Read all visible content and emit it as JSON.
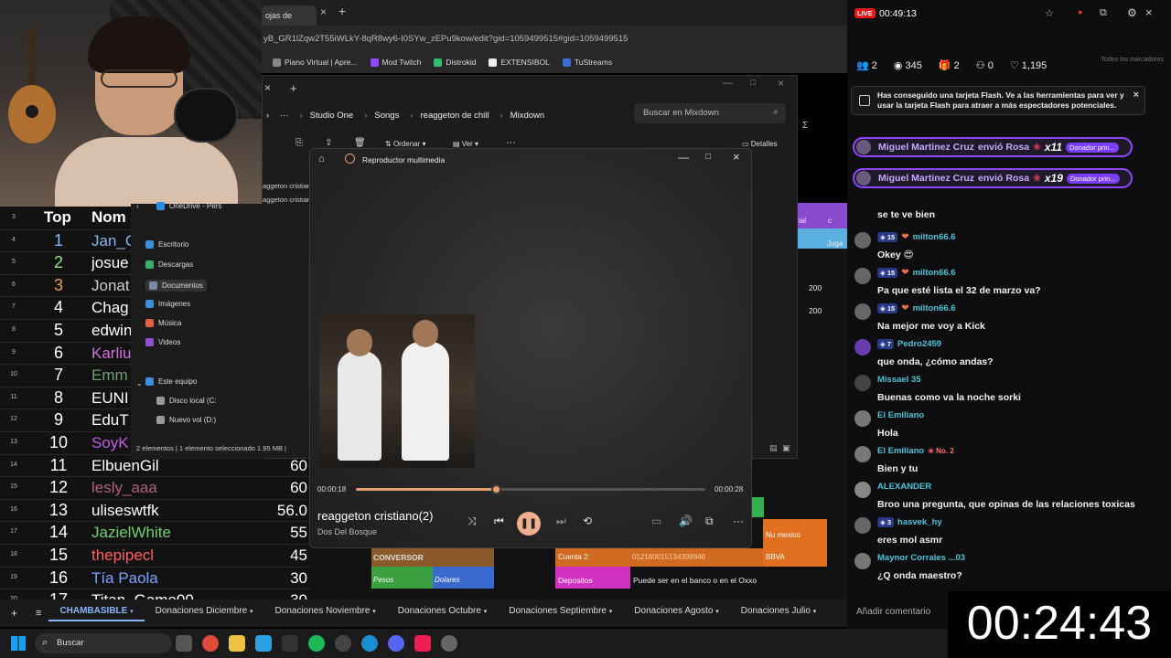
{
  "browser": {
    "tab_label": "ojas de",
    "address": "yB_GR1lZqw2T55iWLkY-8qR8wy6-I0SYw_zEPu9kow/edit?gid=1059499515#gid=1059499515",
    "bookmarks": [
      {
        "label": "Piano Virtual | Apre...",
        "color": "#888888"
      },
      {
        "label": "Mod Twitch",
        "color": "#9147ff"
      },
      {
        "label": "Distrokid",
        "color": "#2fbf71"
      },
      {
        "label": "EXTENSIBOL",
        "color": "#eeeeee"
      },
      {
        "label": "TuStreams",
        "color": "#3a6fd8"
      }
    ]
  },
  "explorer": {
    "breadcrumb": [
      "Studio One",
      "Songs",
      "reaggeton de chill",
      "Mixdown"
    ],
    "search_placeholder": "Buscar en Mixdown",
    "toolbar": {
      "sort": "Ordenar",
      "view": "Ver",
      "details": "Detalles"
    },
    "files": [
      "aggeton cristian",
      "aggeton cristian"
    ],
    "nav": [
      {
        "label": "OneDrive - Pers",
        "color": "#2a8de0"
      },
      {
        "label": "Escritorio",
        "color": "#3a8fe0"
      },
      {
        "label": "Descargas",
        "color": "#3ab070"
      },
      {
        "label": "Documentos",
        "color": "#7a8aa0"
      },
      {
        "label": "Imágenes",
        "color": "#3a8fe0"
      },
      {
        "label": "Música",
        "color": "#e06040"
      },
      {
        "label": "Videos",
        "color": "#9050d0"
      },
      {
        "label": "Este equipo",
        "color": "#3a8fe0"
      },
      {
        "label": "Disco local (C:",
        "color": "#999999"
      },
      {
        "label": "Nuevo vol (D:)",
        "color": "#999999"
      }
    ],
    "status": "2 elementos  |  1 elemento seleccionado  1.95 MB  |"
  },
  "player": {
    "title": "Reproductor multimedia",
    "song": "reaggeton cristiano(2)",
    "artist": "Dos Del Bosque",
    "elapsed": "00:00:18",
    "total": "00:00:28",
    "progress": 0.4,
    "accent": "#e8a070"
  },
  "sheet": {
    "headers": {
      "rank": "Top",
      "name": "Nom"
    },
    "rows": [
      {
        "rn": "3",
        "rank": "",
        "name": "",
        "amt": "",
        "rank_color": "#ffffff",
        "name_color": "#ffffff"
      },
      {
        "rn": "4",
        "rank": "1",
        "name": "Jan_C",
        "amt": "",
        "rank_color": "#8ab4f8",
        "name_color": "#8ab4f8"
      },
      {
        "rn": "5",
        "rank": "2",
        "name": "josue",
        "amt": "",
        "rank_color": "#9be28a",
        "name_color": "#ffffff"
      },
      {
        "rn": "6",
        "rank": "3",
        "name": "Jonat",
        "amt": "",
        "rank_color": "#f0a050",
        "name_color": "#cccccc"
      },
      {
        "rn": "7",
        "rank": "4",
        "name": "Chag",
        "amt": "",
        "rank_color": "#ffffff",
        "name_color": "#ffffff"
      },
      {
        "rn": "8",
        "rank": "5",
        "name": "edwin",
        "amt": "",
        "rank_color": "#ffffff",
        "name_color": "#ffffff"
      },
      {
        "rn": "9",
        "rank": "6",
        "name": "Karliu",
        "amt": "",
        "rank_color": "#ffffff",
        "name_color": "#d070e0"
      },
      {
        "rn": "10",
        "rank": "7",
        "name": "Emm",
        "amt": "",
        "rank_color": "#ffffff",
        "name_color": "#70a070"
      },
      {
        "rn": "11",
        "rank": "8",
        "name": "EUNI",
        "amt": "",
        "rank_color": "#ffffff",
        "name_color": "#ffffff"
      },
      {
        "rn": "12",
        "rank": "9",
        "name": "EduT",
        "amt": "",
        "rank_color": "#ffffff",
        "name_color": "#ffffff"
      },
      {
        "rn": "13",
        "rank": "10",
        "name": "SoyK",
        "amt": "",
        "rank_color": "#ffffff",
        "name_color": "#c060e0"
      },
      {
        "rn": "14",
        "rank": "11",
        "name": "ElbuenGil",
        "amt": "60",
        "rank_color": "#ffffff",
        "name_color": "#ffffff"
      },
      {
        "rn": "15",
        "rank": "12",
        "name": "lesly_aaa",
        "amt": "60",
        "rank_color": "#ffffff",
        "name_color": "#b06080"
      },
      {
        "rn": "16",
        "rank": "13",
        "name": "uliseswtfk",
        "amt": "56.0",
        "rank_color": "#ffffff",
        "name_color": "#ffffff"
      },
      {
        "rn": "17",
        "rank": "14",
        "name": "JazielWhite",
        "amt": "55",
        "rank_color": "#ffffff",
        "name_color": "#70d070"
      },
      {
        "rn": "18",
        "rank": "15",
        "name": "thepipecl",
        "amt": "45",
        "rank_color": "#ffffff",
        "name_color": "#ff6060"
      },
      {
        "rn": "19",
        "rank": "16",
        "name": "Tía Paola",
        "amt": "30",
        "rank_color": "#ffffff",
        "name_color": "#80a0ff"
      },
      {
        "rn": "20",
        "rank": "17",
        "name": "Titan_Game00",
        "amt": "30",
        "rank_color": "#ffffff",
        "name_color": "#ffffff"
      }
    ],
    "right_cells": [
      "200",
      "200"
    ],
    "right_labels": [
      "ial",
      "c",
      "Juga"
    ],
    "conversor": {
      "title": "CONVERSOR",
      "pesos": "Pesos",
      "dolares": "Dolares"
    },
    "cuenta": {
      "label": "Cuenta 2:",
      "number": "012180015134399946"
    },
    "bank": {
      "label": "Nu mexico",
      "name": "BBVA"
    },
    "depositos": {
      "label": "Depositos",
      "note": "Puede ser en el banco o en el Oxxo"
    },
    "tabs": [
      "CHAMBASIBLE",
      "Donaciones Diciembre",
      "Donaciones Noviembre",
      "Donaciones Octubre",
      "Donaciones Septiembre",
      "Donaciones Agosto",
      "Donaciones Julio"
    ]
  },
  "chat": {
    "live_label": "LIVE",
    "uptime": "00:49:13",
    "stats": {
      "people": "2",
      "viewers": "345",
      "gifts": "2",
      "users": "0",
      "likes": "1,195"
    },
    "bookmarks_note": "Todos los marcadores",
    "flash_notice": "Has conseguido una tarjeta Flash. Ve a las herramientas para ver y usar la tarjeta Flash para atraer a más espectadores potenciales.",
    "gifts": [
      {
        "user": "Miguel Martinez Cruz",
        "action": "envió Rosa",
        "mult": "x11",
        "badge": "Donador prin..."
      },
      {
        "user": "Miguel Martinez Cruz",
        "action": "envió Rosa",
        "mult": "x19",
        "badge": "Donador prin..."
      }
    ],
    "messages": [
      {
        "user": "",
        "level": "",
        "text": "se te ve bien",
        "color": "#ffffff",
        "avatar": "#555555"
      },
      {
        "user": "milton66.6",
        "level": "15",
        "text": "Okey 😍",
        "color": "#4fc3d8",
        "avatar": "#666666"
      },
      {
        "user": "milton66.6",
        "level": "15",
        "text": "Pa que esté lista el 32 de marzo va?",
        "color": "#4fc3d8",
        "avatar": "#666666"
      },
      {
        "user": "milton66.6",
        "level": "15",
        "text": "Na mejor me voy a Kick",
        "color": "#4fc3d8",
        "avatar": "#666666"
      },
      {
        "user": "Pedro2459",
        "level": "7",
        "text": "que onda, ¿cómo andas?",
        "color": "#4fc3d8",
        "avatar": "#6a3ab0"
      },
      {
        "user": "Missael 35",
        "level": "",
        "text": "Buenas como va la noche sorki",
        "color": "#4fc3d8",
        "avatar": "#444444"
      },
      {
        "user": "El Emiliano",
        "level": "",
        "text": "Hola",
        "color": "#4fc3d8",
        "avatar": "#777777"
      },
      {
        "user": "El Emiliano",
        "level": "",
        "rank": "No. 2",
        "text": "Bien y tu",
        "color": "#4fc3d8",
        "avatar": "#777777"
      },
      {
        "user": "ALEXANDER",
        "level": "",
        "text": "Broo una pregunta, que opinas de las relaciones toxicas",
        "color": "#4fc3d8",
        "avatar": "#888888"
      },
      {
        "user": "hasvek_hy",
        "level": "3",
        "text": "eres mol asmr",
        "color": "#4fc3d8",
        "avatar": "#666666"
      },
      {
        "user": "Maynor Corrales ...03",
        "level": "",
        "text": "¿Q onda maestro?",
        "color": "#4fc3d8",
        "avatar": "#777777"
      }
    ],
    "add_comment": "Añadir comentario"
  },
  "timer": "00:24:43",
  "taskbar": {
    "search_label": "Buscar",
    "apps": [
      {
        "name": "task-view",
        "color": "#555555"
      },
      {
        "name": "chrome",
        "color": "#e04a3a"
      },
      {
        "name": "file-explorer",
        "color": "#f0c040"
      },
      {
        "name": "telegram",
        "color": "#2aa0e0"
      },
      {
        "name": "capcut",
        "color": "#333333"
      },
      {
        "name": "spotify",
        "color": "#1db954"
      },
      {
        "name": "obs",
        "color": "#444444"
      },
      {
        "name": "edge",
        "color": "#1a8fd0"
      },
      {
        "name": "discord",
        "color": "#5865f2"
      },
      {
        "name": "tiktok",
        "color": "#ee1d52"
      },
      {
        "name": "media-player",
        "color": "#666666"
      }
    ]
  }
}
